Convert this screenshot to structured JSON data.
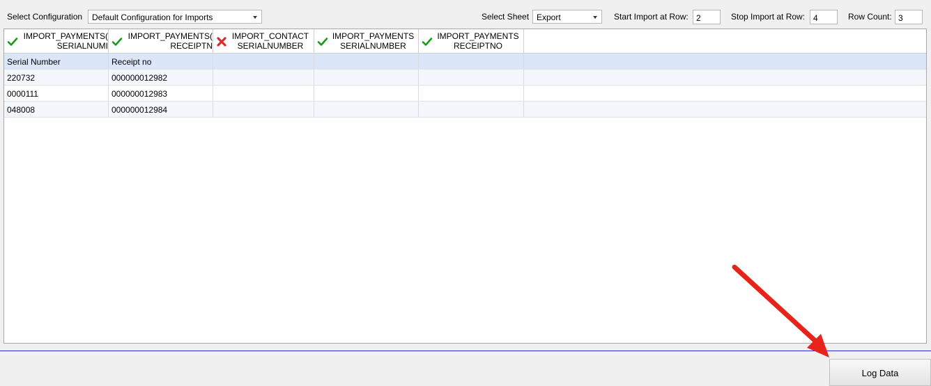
{
  "toolbar": {
    "config_label": "Select Configuration",
    "config_value": "Default Configuration for Imports",
    "sheet_label": "Select Sheet",
    "sheet_value": "Export",
    "start_label": "Start Import at Row:",
    "start_value": "2",
    "stop_label": "Stop Import at Row:",
    "stop_value": "4",
    "count_label": "Row Count:",
    "count_value": "3"
  },
  "grid": {
    "columns": [
      {
        "line1": "IMPORT_PAYMENTS(",
        "line2": "SERIALNUMI",
        "status": "ok",
        "status_icon": "check-icon"
      },
      {
        "line1": "IMPORT_PAYMENTS(",
        "line2": "RECEIPTN",
        "status": "ok",
        "status_icon": "check-icon"
      },
      {
        "line1": "IMPORT_CONTACT",
        "line2": "SERIALNUMBER",
        "status": "error",
        "status_icon": "cross-icon"
      },
      {
        "line1": "IMPORT_PAYMENTS",
        "line2": "SERIALNUMBER",
        "status": "ok",
        "status_icon": "check-icon"
      },
      {
        "line1": "IMPORT_PAYMENTS",
        "line2": "RECEIPTNO",
        "status": "ok",
        "status_icon": "check-icon"
      }
    ],
    "rows": [
      [
        "Serial Number",
        "Receipt no",
        "",
        "",
        ""
      ],
      [
        "220732",
        "000000012982",
        "",
        "",
        ""
      ],
      [
        "0000111",
        "000000012983",
        "",
        "",
        ""
      ],
      [
        "048008",
        "000000012984",
        "",
        "",
        ""
      ]
    ]
  },
  "footer": {
    "log_button": "Log Data"
  },
  "colors": {
    "ok": "#1a9a1a",
    "error": "#d92b2b",
    "arrow": "#e8231c",
    "divider": "#2b2bd0"
  }
}
